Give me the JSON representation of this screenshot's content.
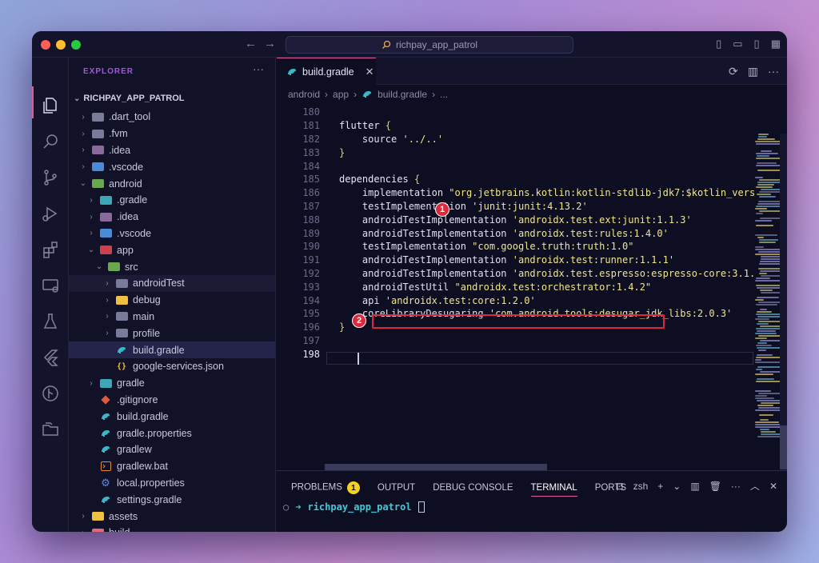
{
  "titlebar": {
    "search_text": "richpay_app_patrol"
  },
  "sidebar": {
    "header": "EXPLORER",
    "project_title": "RICHPAY_APP_PATROL",
    "items": [
      {
        "label": ".dart_tool",
        "indent": 1,
        "kind": "folder",
        "color": "#7a7a9a",
        "chevron": "›"
      },
      {
        "label": ".fvm",
        "indent": 1,
        "kind": "folder",
        "color": "#7a7a9a",
        "chevron": "›"
      },
      {
        "label": ".idea",
        "indent": 1,
        "kind": "folder",
        "color": "#8a6a9a",
        "chevron": "›"
      },
      {
        "label": ".vscode",
        "indent": 1,
        "kind": "folder",
        "color": "#4a8ad8",
        "chevron": "›"
      },
      {
        "label": "android",
        "indent": 1,
        "kind": "folder",
        "color": "#6aa84f",
        "chevron": "⌄"
      },
      {
        "label": ".gradle",
        "indent": 2,
        "kind": "folder",
        "color": "#3aa8b8",
        "chevron": "›"
      },
      {
        "label": ".idea",
        "indent": 2,
        "kind": "folder",
        "color": "#8a6a9a",
        "chevron": "›"
      },
      {
        "label": ".vscode",
        "indent": 2,
        "kind": "folder",
        "color": "#4a8ad8",
        "chevron": "›"
      },
      {
        "label": "app",
        "indent": 2,
        "kind": "folder",
        "color": "#d0404a",
        "chevron": "⌄"
      },
      {
        "label": "src",
        "indent": 3,
        "kind": "folder",
        "color": "#6aa84f",
        "chevron": "⌄"
      },
      {
        "label": "androidTest",
        "indent": 4,
        "kind": "folder",
        "color": "#7a7a9a",
        "chevron": "›",
        "state": "hover"
      },
      {
        "label": "debug",
        "indent": 4,
        "kind": "folder",
        "color": "#f0c040",
        "chevron": "›"
      },
      {
        "label": "main",
        "indent": 4,
        "kind": "folder",
        "color": "#7a7a9a",
        "chevron": "›"
      },
      {
        "label": "profile",
        "indent": 4,
        "kind": "folder",
        "color": "#7a7a9a",
        "chevron": "›"
      },
      {
        "label": "build.gradle",
        "indent": 4,
        "kind": "gradle",
        "color": "#3ab8c8",
        "chevron": "",
        "state": "selected"
      },
      {
        "label": "google-services.json",
        "indent": 4,
        "kind": "json",
        "color": "#f0c040",
        "chevron": ""
      },
      {
        "label": "gradle",
        "indent": 2,
        "kind": "folder",
        "color": "#3aa8b8",
        "chevron": "›"
      },
      {
        "label": ".gitignore",
        "indent": 2,
        "kind": "git",
        "color": "#e05a3a",
        "chevron": ""
      },
      {
        "label": "build.gradle",
        "indent": 2,
        "kind": "gradle",
        "color": "#3ab8c8",
        "chevron": ""
      },
      {
        "label": "gradle.properties",
        "indent": 2,
        "kind": "gradle",
        "color": "#3ab8c8",
        "chevron": ""
      },
      {
        "label": "gradlew",
        "indent": 2,
        "kind": "gradle",
        "color": "#3ab8c8",
        "chevron": ""
      },
      {
        "label": "gradlew.bat",
        "indent": 2,
        "kind": "bat",
        "color": "#e08a3a",
        "chevron": ""
      },
      {
        "label": "local.properties",
        "indent": 2,
        "kind": "gear",
        "color": "#6a8ad8",
        "chevron": ""
      },
      {
        "label": "settings.gradle",
        "indent": 2,
        "kind": "gradle",
        "color": "#3ab8c8",
        "chevron": ""
      },
      {
        "label": "assets",
        "indent": 1,
        "kind": "folder",
        "color": "#f0c040",
        "chevron": "›"
      },
      {
        "label": "build",
        "indent": 1,
        "kind": "folder",
        "color": "#e06a7a",
        "chevron": "›"
      }
    ]
  },
  "editor": {
    "tab_label": "build.gradle",
    "breadcrumbs": [
      "android",
      "app",
      "build.gradle",
      "..."
    ],
    "lines": [
      {
        "n": "180",
        "segs": []
      },
      {
        "n": "181",
        "segs": [
          {
            "t": "flutter ",
            "c": "kw"
          },
          {
            "t": "{",
            "c": "brace"
          }
        ]
      },
      {
        "n": "182",
        "segs": [
          {
            "t": "    source ",
            "c": "txt"
          },
          {
            "t": "'../..'",
            "c": "str"
          }
        ]
      },
      {
        "n": "183",
        "segs": [
          {
            "t": "}",
            "c": "brace"
          }
        ]
      },
      {
        "n": "184",
        "segs": []
      },
      {
        "n": "185",
        "segs": [
          {
            "t": "dependencies ",
            "c": "kw"
          },
          {
            "t": "{",
            "c": "brace"
          }
        ]
      },
      {
        "n": "186",
        "segs": [
          {
            "t": "    implementation ",
            "c": "txt"
          },
          {
            "t": "\"org.jetbrains.kotlin:kotlin-stdlib-jdk7:$kotlin_vers",
            "c": "str"
          }
        ]
      },
      {
        "n": "187",
        "segs": [
          {
            "t": "    testImplementation ",
            "c": "txt"
          },
          {
            "t": "'junit:junit:4.13.2'",
            "c": "str"
          }
        ]
      },
      {
        "n": "188",
        "segs": [
          {
            "t": "    androidTestImplementation ",
            "c": "txt"
          },
          {
            "t": "'androidx.test.ext:junit:1.1.3'",
            "c": "str"
          }
        ]
      },
      {
        "n": "189",
        "segs": [
          {
            "t": "    androidTestImplementation ",
            "c": "txt"
          },
          {
            "t": "'androidx.test:rules:1.4.0'",
            "c": "str"
          }
        ]
      },
      {
        "n": "190",
        "segs": [
          {
            "t": "    testImplementation ",
            "c": "txt"
          },
          {
            "t": "\"com.google.truth:truth:1.0\"",
            "c": "str"
          }
        ]
      },
      {
        "n": "191",
        "segs": [
          {
            "t": "    androidTestImplementation ",
            "c": "txt"
          },
          {
            "t": "'androidx.test:runner:1.1.1'",
            "c": "str"
          }
        ]
      },
      {
        "n": "192",
        "segs": [
          {
            "t": "    androidTestImplementation ",
            "c": "txt"
          },
          {
            "t": "'androidx.test.espresso:espresso-core:3.1.",
            "c": "str"
          }
        ]
      },
      {
        "n": "193",
        "segs": [
          {
            "t": "    androidTestUtil ",
            "c": "txt"
          },
          {
            "t": "\"androidx.test:orchestrator:1.4.2\"",
            "c": "str"
          }
        ]
      },
      {
        "n": "194",
        "segs": [
          {
            "t": "    api ",
            "c": "txt"
          },
          {
            "t": "'androidx.test:core:1.2.0'",
            "c": "str"
          }
        ]
      },
      {
        "n": "195",
        "segs": [
          {
            "t": "    coreLibraryDesugaring ",
            "c": "txt"
          },
          {
            "t": "'com.android.tools:desugar_jdk_libs:2.0.3'",
            "c": "str"
          }
        ]
      },
      {
        "n": "196",
        "segs": [
          {
            "t": "}",
            "c": "brace"
          }
        ]
      },
      {
        "n": "197",
        "segs": []
      },
      {
        "n": "198",
        "segs": [],
        "current": true
      }
    ],
    "annotations": [
      {
        "label": "1"
      },
      {
        "label": "2"
      }
    ]
  },
  "panel": {
    "tabs": [
      {
        "label": "PROBLEMS",
        "count": "1"
      },
      {
        "label": "OUTPUT"
      },
      {
        "label": "DEBUG CONSOLE"
      },
      {
        "label": "TERMINAL",
        "active": true
      },
      {
        "label": "PORTS"
      }
    ],
    "shell": "zsh",
    "prompt_dir": "richpay_app_patrol"
  },
  "colors": {
    "accent": "#e05a9a",
    "annotation_red": "#e0283c",
    "problems_badge": "#f5d020"
  }
}
